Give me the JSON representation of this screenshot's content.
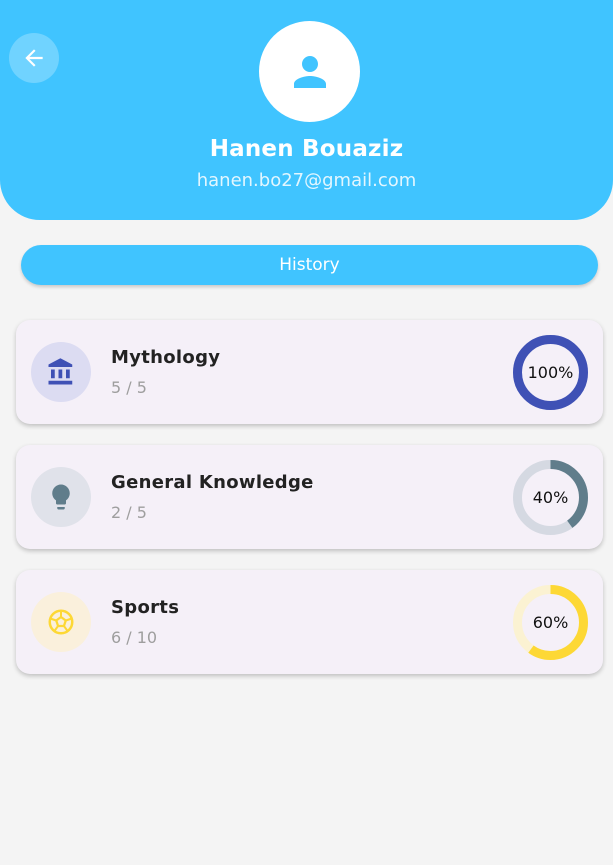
{
  "header": {
    "name": "Hanen Bouaziz",
    "email": "hanen.bo27@gmail.com",
    "bg_color": "#40c4ff",
    "back_icon": "arrow-left-icon",
    "avatar_icon": "person-icon"
  },
  "history_label": "History",
  "cards": [
    {
      "title": "Mythology",
      "score": "5 / 5",
      "percent_label": "100%",
      "progress": 1.0,
      "icon": "bank-icon",
      "color": "#3f51b5",
      "icon_bg": "#dcdcf2",
      "track_color": "#c5cae9"
    },
    {
      "title": "General Knowledge",
      "score": "2 / 5",
      "percent_label": "40%",
      "progress": 0.4,
      "icon": "lightbulb-icon",
      "color": "#607d8b",
      "icon_bg": "#e0e2ea",
      "track_color": "#d5d9e2"
    },
    {
      "title": "Sports",
      "score": "6 / 10",
      "percent_label": "60%",
      "progress": 0.6,
      "icon": "soccer-ball-icon",
      "color": "#fdd835",
      "icon_bg": "#faf0dc",
      "track_color": "#fbf2d2"
    }
  ]
}
